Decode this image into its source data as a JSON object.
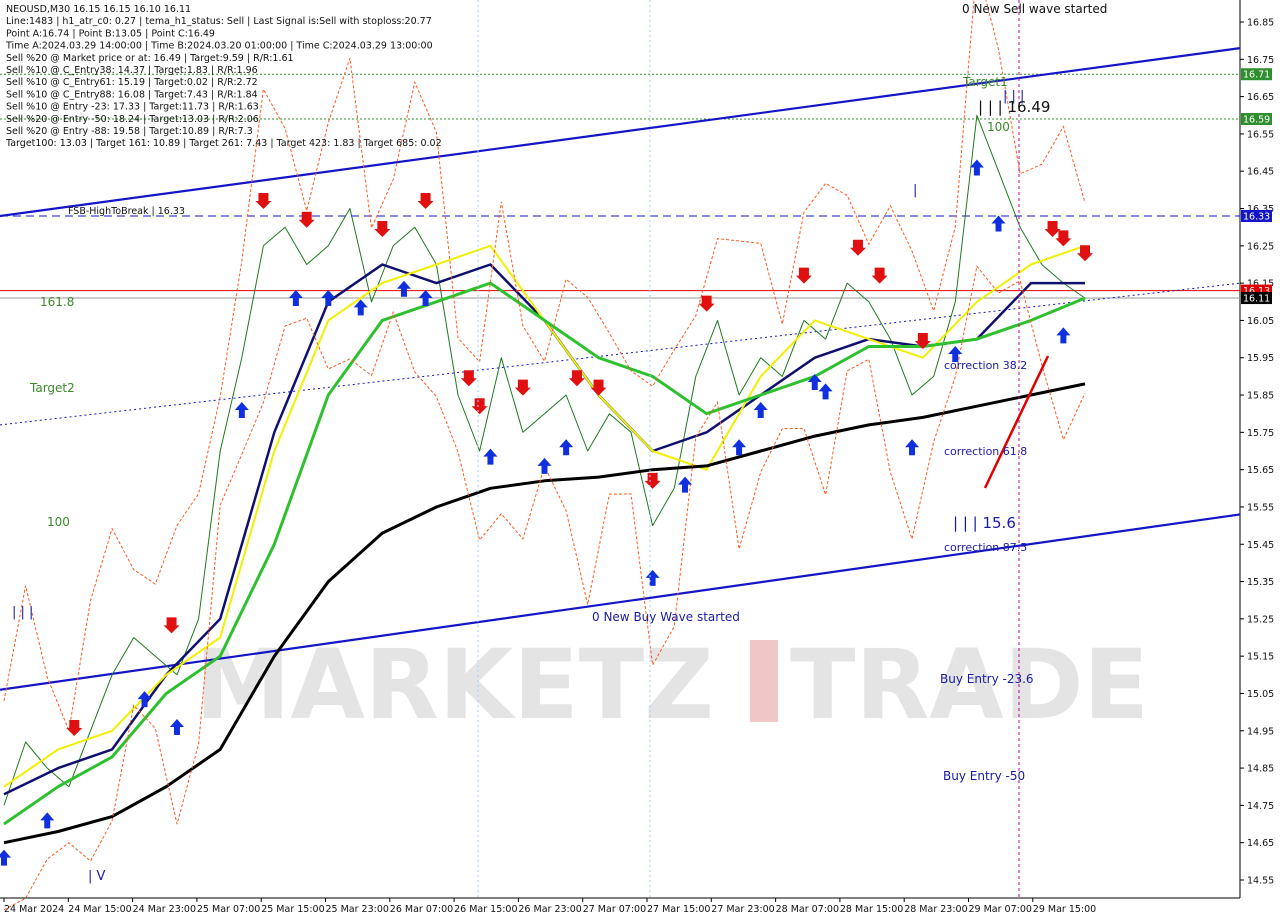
{
  "info_lines": [
    "NEOUSD,M30  16.15 16.15 16.10 16.11",
    "Line:1483  | h1_atr_c0: 0.27  | tema_h1_status: Sell  | Last Signal is:Sell with stoploss:20.77",
    "Point A:16.74  | Point B:13.05  | Point C:16.49",
    "Time A:2024.03.29 14:00:00  | Time B:2024.03.20 01:00:00  | Time C:2024.03.29 13:00:00",
    "Sell %20 @ Market price or at: 16.49  | Target:9.59  | R/R:1.61",
    "Sell %10 @ C_Entry38: 14.37  | Target:1.83  | R/R:1.96",
    "Sell %10 @ C_Entry61: 15.19  | Target:0.02  | R/R:2.72",
    "Sell %10 @ C_Entry88: 16.08  | Target:7.43  | R/R:1.84",
    "Sell %10 @ Entry -23: 17.33  | Target:11.73  | R/R:1.63",
    "Sell %20 @ Entry -50: 18.24  | Target:13.03  | R/R:2.06",
    "Sell %20 @ Entry -88: 19.58  | Target:10.89  | R/R:7.3",
    "Target100: 13.03  | Target 161: 10.89  | Target 261: 7.43  | Target 423: 1.83  | Target 685: 0.02"
  ],
  "labels": {
    "sell_wave": "0 New Sell wave started",
    "buy_wave": "0 New Buy Wave started",
    "target1": "Target1",
    "target2": "Target2",
    "fib_1618": "161.8",
    "fib_100_left": "100",
    "fib_100_right": "100",
    "point_c": "| | | 16.49",
    "point_low": "| | | 15.6",
    "fsb": "FSB-HighToBreak | 16.33",
    "correction_382": "correction 38.2",
    "correction_618": "correction 61.8",
    "correction_875": "correction 87.5",
    "buy_entry_236": "Buy Entry -23.6",
    "buy_entry_50": "Buy Entry -50",
    "tick_marks_left": "| | |",
    "tick_marks_bottom": "| V",
    "tick_marks_top": "| | |",
    "tick_single": "|"
  },
  "watermark": {
    "part1": "MARKETZ",
    "part2": "I",
    "part3": "TRADE"
  },
  "colors": {
    "background": "#ffffff",
    "candle": "#1f7a1f",
    "ema_navy": "#10106e",
    "ema_yellow": "#f0f000",
    "ema_green": "#2ec02e",
    "ema_black": "#000000",
    "channel_blue": "#1515c8",
    "envelope": "#ff5a1e",
    "target_green": "#2f8f2f",
    "price_red": "#e00000",
    "magenta": "#c000a0",
    "buy_arrow": "#1030e0",
    "sell_arrow": "#e01010"
  },
  "chart_data": {
    "type": "line",
    "symbol": "NEOUSD",
    "timeframe": "M30",
    "ylim": [
      14.5,
      16.9
    ],
    "y_ticks": [
      "16.85",
      "16.75",
      "16.65",
      "16.55",
      "16.45",
      "16.35",
      "16.25",
      "16.15",
      "16.05",
      "15.95",
      "15.85",
      "15.75",
      "15.65",
      "15.55",
      "15.45",
      "15.35",
      "15.25",
      "15.15",
      "15.05",
      "14.95",
      "14.85",
      "14.75",
      "14.65",
      "14.55"
    ],
    "x_ticks": [
      "24 Mar 2024",
      "24 Mar 15:00",
      "24 Mar 23:00",
      "25 Mar 07:00",
      "25 Mar 15:00",
      "25 Mar 23:00",
      "26 Mar 07:00",
      "26 Mar 15:00",
      "26 Mar 23:00",
      "27 Mar 07:00",
      "27 Mar 15:00",
      "27 Mar 23:00",
      "28 Mar 07:00",
      "28 Mar 15:00",
      "28 Mar 23:00",
      "29 Mar 07:00",
      "29 Mar 15:00"
    ],
    "price_badges": [
      {
        "label": "16.71",
        "value": 16.71,
        "color": "#2f8f2f"
      },
      {
        "label": "16.59",
        "value": 16.59,
        "color": "#2f8f2f"
      },
      {
        "label": "16.33",
        "value": 16.33,
        "color": "#1515c8"
      },
      {
        "label": "16.13",
        "value": 16.13,
        "color": "#e00000"
      },
      {
        "label": "16.11",
        "value": 16.11,
        "color": "#000000"
      }
    ],
    "horizontal_levels": [
      {
        "name": "Target1",
        "value": 16.71,
        "style": "dotted",
        "color": "#2f8f2f"
      },
      {
        "name": "16.59",
        "value": 16.59,
        "style": "dotted",
        "color": "#2f8f2f"
      },
      {
        "name": "FSB-HighToBreak",
        "value": 16.33,
        "style": "dashed",
        "color": "#1515c8"
      },
      {
        "name": "bid",
        "value": 16.13,
        "style": "solid",
        "color": "#e00000"
      },
      {
        "name": "close",
        "value": 16.11,
        "style": "solid",
        "color": "#999999"
      }
    ],
    "channel_upper": {
      "from": [
        0,
        16.33
      ],
      "to": [
        1240,
        16.78
      ]
    },
    "channel_lower": {
      "from": [
        0,
        15.06
      ],
      "to": [
        1240,
        15.53
      ]
    },
    "midline_dotted": {
      "from": [
        0,
        15.77
      ],
      "to": [
        1240,
        16.15
      ]
    },
    "series": [
      {
        "name": "close",
        "color": "#1f7a1f",
        "width": 1,
        "t": [
          0,
          0.02,
          0.04,
          0.06,
          0.08,
          0.1,
          0.12,
          0.14,
          0.16,
          0.18,
          0.2,
          0.22,
          0.24,
          0.26,
          0.28,
          0.3,
          0.32,
          0.34,
          0.36,
          0.38,
          0.4,
          0.42,
          0.44,
          0.46,
          0.48,
          0.5,
          0.52,
          0.54,
          0.56,
          0.58,
          0.6,
          0.62,
          0.64,
          0.66,
          0.68,
          0.7,
          0.72,
          0.74,
          0.76,
          0.78,
          0.8,
          0.82,
          0.84,
          0.86,
          0.88,
          0.9,
          0.92,
          0.94,
          0.96,
          0.98,
          1.0
        ],
        "v": [
          14.75,
          14.92,
          14.85,
          14.8,
          14.95,
          15.1,
          15.2,
          15.15,
          15.1,
          15.25,
          15.7,
          15.95,
          16.25,
          16.3,
          16.2,
          16.25,
          16.35,
          16.1,
          16.25,
          16.3,
          16.2,
          15.85,
          15.7,
          15.95,
          15.75,
          15.8,
          15.85,
          15.7,
          15.8,
          15.75,
          15.5,
          15.6,
          15.9,
          16.05,
          15.85,
          15.95,
          15.9,
          16.05,
          16.0,
          16.15,
          16.1,
          16.0,
          15.85,
          15.9,
          16.1,
          16.6,
          16.45,
          16.3,
          16.2,
          16.15,
          16.11
        ]
      },
      {
        "name": "ema_navy",
        "color": "#10106e",
        "width": 2.5,
        "t": [
          0,
          0.05,
          0.1,
          0.15,
          0.2,
          0.25,
          0.3,
          0.35,
          0.4,
          0.45,
          0.5,
          0.55,
          0.6,
          0.65,
          0.7,
          0.75,
          0.8,
          0.85,
          0.9,
          0.95,
          1.0
        ],
        "v": [
          14.78,
          14.85,
          14.9,
          15.1,
          15.25,
          15.75,
          16.1,
          16.2,
          16.15,
          16.2,
          16.05,
          15.85,
          15.7,
          15.75,
          15.85,
          15.95,
          16.0,
          15.98,
          16.0,
          16.15,
          16.15
        ]
      },
      {
        "name": "ema_yellow",
        "color": "#f0f000",
        "width": 2,
        "t": [
          0,
          0.05,
          0.1,
          0.15,
          0.2,
          0.25,
          0.3,
          0.35,
          0.4,
          0.45,
          0.5,
          0.55,
          0.6,
          0.65,
          0.7,
          0.75,
          0.8,
          0.85,
          0.9,
          0.95,
          1.0
        ],
        "v": [
          14.8,
          14.9,
          14.95,
          15.1,
          15.2,
          15.7,
          16.05,
          16.15,
          16.2,
          16.25,
          16.05,
          15.85,
          15.7,
          15.65,
          15.9,
          16.05,
          16.0,
          15.95,
          16.1,
          16.2,
          16.25
        ]
      },
      {
        "name": "ema_green",
        "color": "#2ec02e",
        "width": 3,
        "t": [
          0,
          0.05,
          0.1,
          0.15,
          0.2,
          0.25,
          0.3,
          0.35,
          0.4,
          0.45,
          0.5,
          0.55,
          0.6,
          0.65,
          0.7,
          0.75,
          0.8,
          0.85,
          0.9,
          0.95,
          1.0
        ],
        "v": [
          14.7,
          14.8,
          14.88,
          15.05,
          15.15,
          15.45,
          15.85,
          16.05,
          16.1,
          16.15,
          16.05,
          15.95,
          15.9,
          15.8,
          15.85,
          15.9,
          15.98,
          15.98,
          16.0,
          16.05,
          16.11
        ]
      },
      {
        "name": "ema_black",
        "color": "#000000",
        "width": 3,
        "t": [
          0,
          0.05,
          0.1,
          0.15,
          0.2,
          0.25,
          0.3,
          0.35,
          0.4,
          0.45,
          0.5,
          0.55,
          0.6,
          0.65,
          0.7,
          0.75,
          0.8,
          0.85,
          0.9,
          0.95,
          1.0
        ],
        "v": [
          14.65,
          14.68,
          14.72,
          14.8,
          14.9,
          15.15,
          15.35,
          15.48,
          15.55,
          15.6,
          15.62,
          15.63,
          15.65,
          15.66,
          15.7,
          15.74,
          15.77,
          15.79,
          15.82,
          15.85,
          15.88
        ]
      }
    ],
    "sell_arrows": [
      0.065,
      0.155,
      0.24,
      0.28,
      0.35,
      0.39,
      0.43,
      0.44,
      0.48,
      0.53,
      0.55,
      0.6,
      0.65,
      0.74,
      0.79,
      0.81,
      0.85,
      0.97,
      0.98,
      1.0
    ],
    "buy_arrows": [
      0.0,
      0.04,
      0.13,
      0.16,
      0.22,
      0.27,
      0.3,
      0.33,
      0.37,
      0.39,
      0.45,
      0.5,
      0.52,
      0.6,
      0.63,
      0.68,
      0.7,
      0.75,
      0.76,
      0.84,
      0.88,
      0.9,
      0.92,
      0.98
    ]
  }
}
